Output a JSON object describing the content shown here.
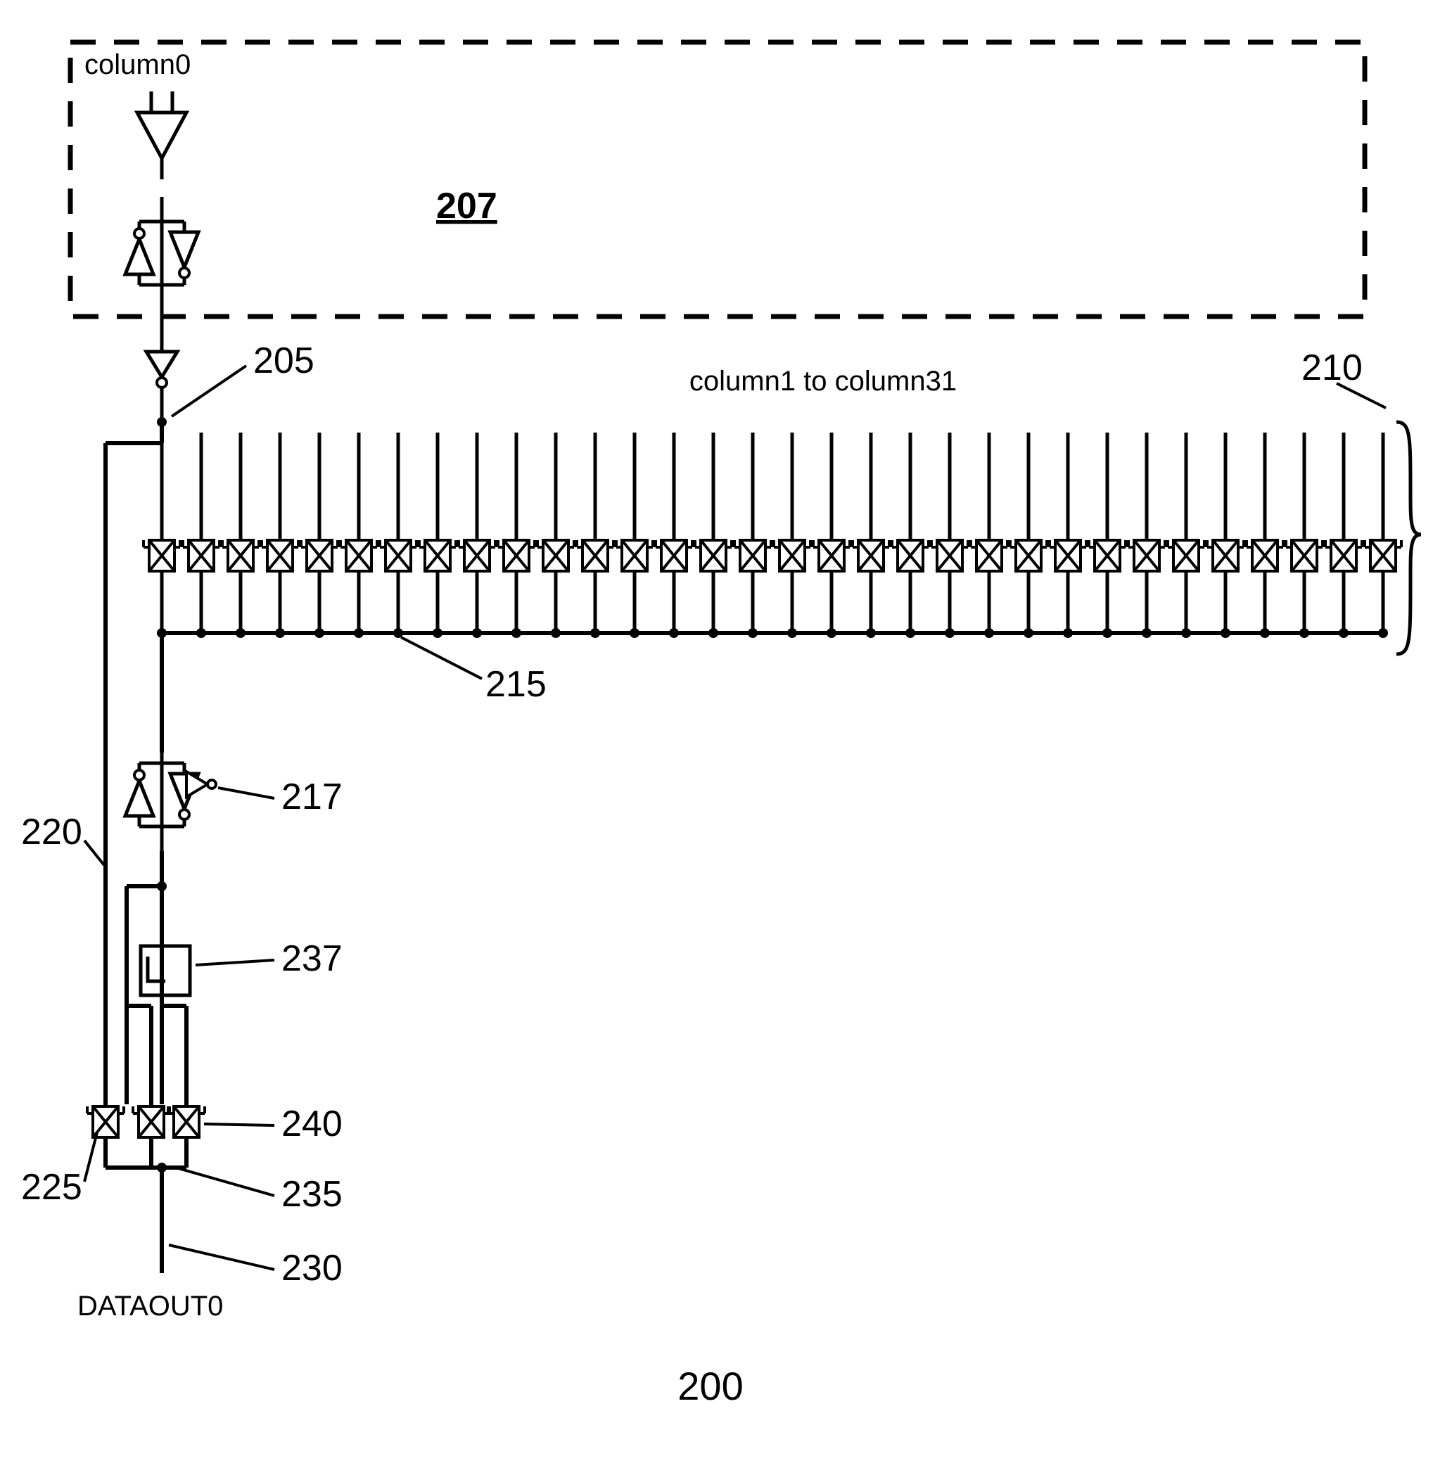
{
  "labels": {
    "column0": "column0",
    "column_range": "column1 to column31",
    "dataout": "DATAOUT0"
  },
  "refs": {
    "ref200": "200",
    "ref205": "205",
    "ref207": "207",
    "ref210": "210",
    "ref215": "215",
    "ref217": "217",
    "ref220": "220",
    "ref225": "225",
    "ref230": "230",
    "ref235": "235",
    "ref237": "237",
    "ref240": "240"
  },
  "num_columns": 32
}
